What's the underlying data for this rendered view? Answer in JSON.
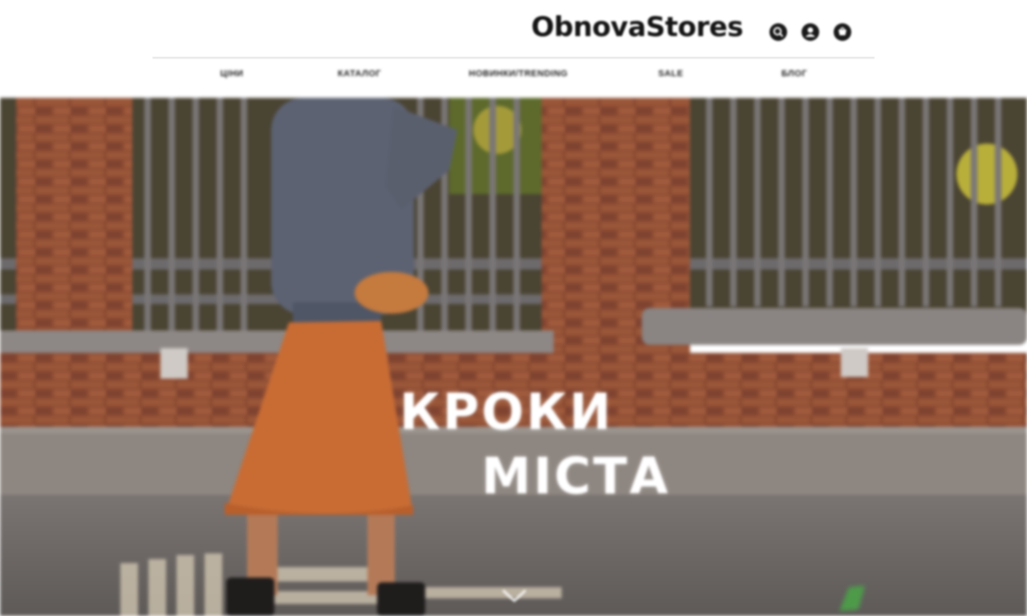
{
  "brand": {
    "logo_text": "ObnovaStores"
  },
  "header_icons": [
    "search-icon",
    "account-icon",
    "cart-icon"
  ],
  "nav": {
    "items": [
      {
        "label": "Ціни"
      },
      {
        "label": "Каталог"
      },
      {
        "label": "Новинки/Trending"
      },
      {
        "label": "Sale"
      },
      {
        "label": "Блог"
      }
    ]
  },
  "hero": {
    "title_line1": "КРОКИ",
    "title_line2": "МІСТА"
  },
  "colors": {
    "brick": "#8a4a32",
    "skirt": "#c86c34",
    "sweater": "#5c6272",
    "pavement": "#6e6a68",
    "heading_text": "#ffffff"
  }
}
